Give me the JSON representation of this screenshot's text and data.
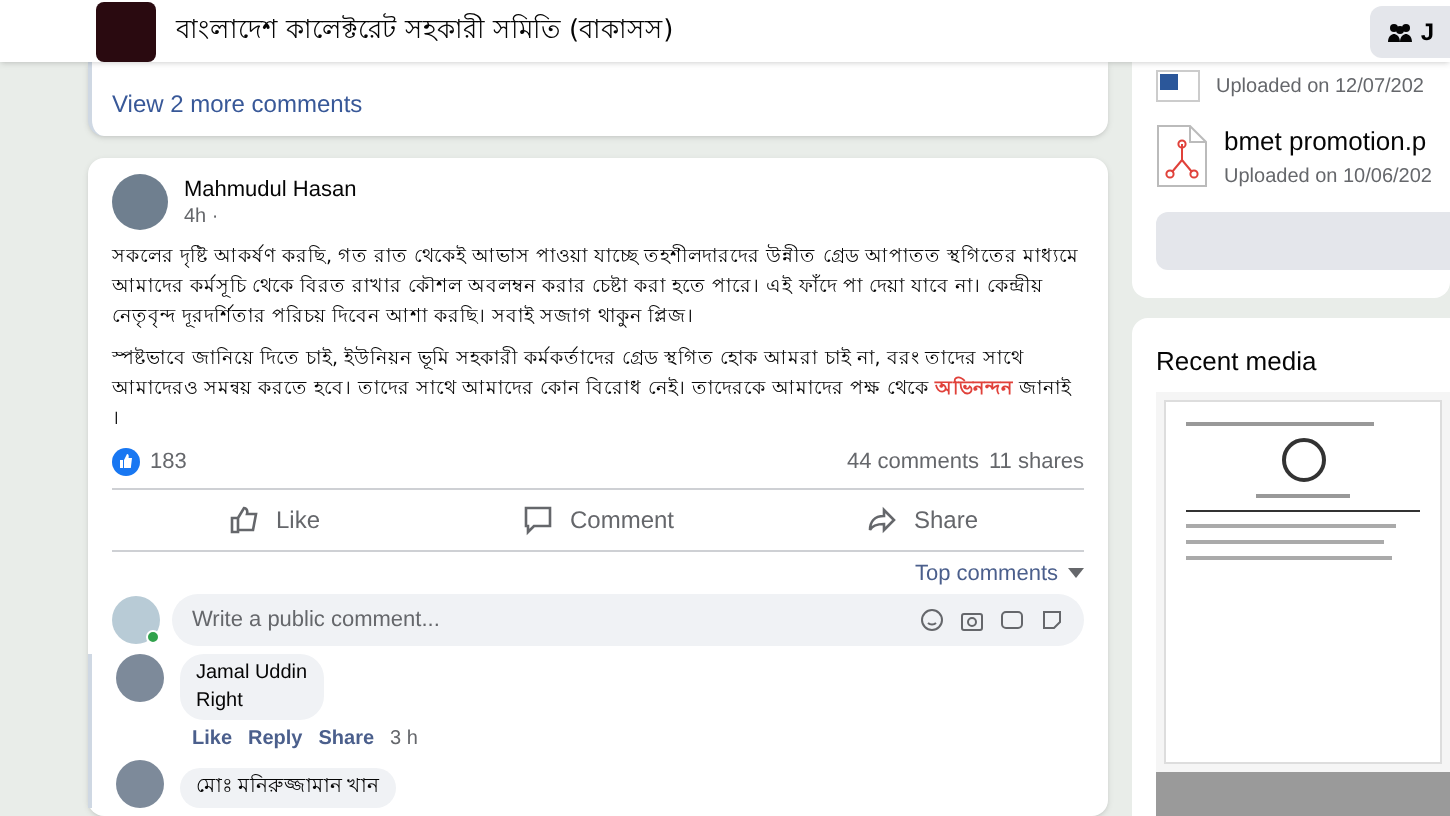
{
  "header": {
    "group_title": "বাংলাদেশ কালেক্টরেট সহকারী সমিতি (বাকাসস)",
    "button_label": "J"
  },
  "previous_post": {
    "view_more": "View 2 more comments"
  },
  "post": {
    "author": "Mahmudul Hasan",
    "time": "4h ·",
    "paragraphs": [
      "সকলের দৃষ্টি আকর্ষণ করছি, গত রাত থেকেই আভাস পাওয়া যাচ্ছে তহশীলদারদের উন্নীত গ্রেড আপাতত স্থগিতের মাধ্যমে আমাদের কর্মসূচি থেকে বিরত রাখার কৌশল অবলম্বন করার চেষ্টা করা হতে পারে। এই ফাঁদে পা দেয়া যাবে না। কেন্দ্রীয় নেতৃবৃন্দ দূরদর্শিতার পরিচয় দিবেন আশা করছি। সবাই সজাগ থাকুন প্লিজ।",
      "স্পষ্টভাবে জানিয়ে দিতে চাই, ইউনিয়ন ভূমি সহকারী কর্মকর্তাদের গ্রেড স্থগিত হোক আমরা চাই না, বরং তাদের সাথে আমাদেরও সমন্বয় করতে হবে। তাদের সাথে আমাদের কোন বিরোধ নেই। তাদেরকে আমাদের পক্ষ থেকে **অভিনন্দন** জানাই ।"
    ],
    "reactions": "183",
    "comments": "44 comments",
    "shares": "11 shares",
    "actions": [
      {
        "kind": "like",
        "label": "Like"
      },
      {
        "kind": "comment",
        "label": "Comment"
      },
      {
        "kind": "share",
        "label": "Share"
      }
    ],
    "sort": "Top comments",
    "comment_placeholder": "Write a public comment...",
    "comments_list": [
      {
        "author": "Jamal Uddin",
        "text": "Right",
        "actions": [
          "Like",
          "Reply",
          "Share"
        ],
        "time": "3 h"
      },
      {
        "author": "মোঃ মনিরুজ্জামান খান"
      }
    ]
  },
  "files": [
    {
      "kind": "word",
      "date": "Uploaded on 12/07/202"
    },
    {
      "kind": "pdf",
      "name": "bmet promotion.p",
      "date": "Uploaded on 10/06/202"
    }
  ],
  "recent_media": {
    "title": "Recent media"
  }
}
